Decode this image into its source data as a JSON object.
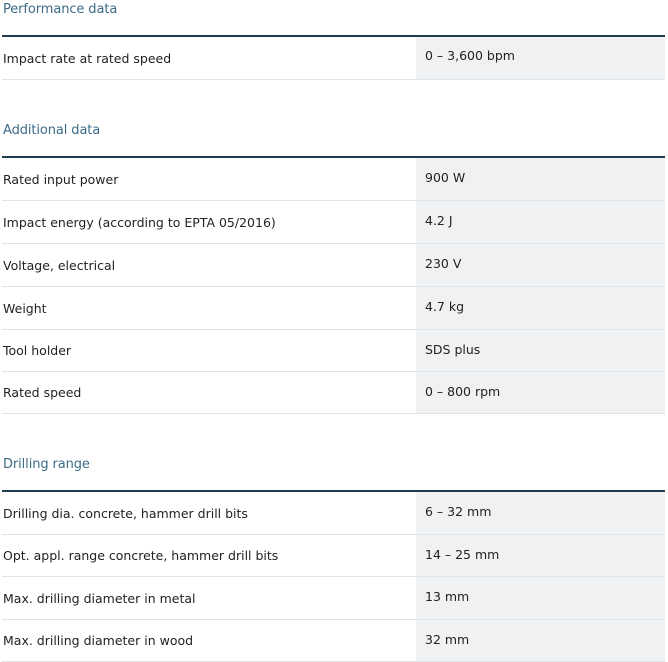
{
  "sections": [
    {
      "title": "Performance data",
      "rows": [
        {
          "label": "Impact rate at rated speed",
          "value": "0 – 3,600 bpm"
        }
      ]
    },
    {
      "title": "Additional data",
      "rows": [
        {
          "label": "Rated input power",
          "value": "900 W"
        },
        {
          "label": "Impact energy (according to EPTA 05/2016)",
          "value": "4.2 J"
        },
        {
          "label": "Voltage, electrical",
          "value": "230 V"
        },
        {
          "label": "Weight",
          "value": "4.7 kg"
        },
        {
          "label": "Tool holder",
          "value": "SDS plus"
        },
        {
          "label": "Rated speed",
          "value": "0 – 800 rpm"
        }
      ]
    },
    {
      "title": "Drilling range",
      "rows": [
        {
          "label": "Drilling dia. concrete, hammer drill bits",
          "value": "6 – 32 mm"
        },
        {
          "label": "Opt. appl. range concrete, hammer drill bits",
          "value": "14 – 25 mm"
        },
        {
          "label": "Max. drilling diameter in metal",
          "value": "13 mm"
        },
        {
          "label": "Max. drilling diameter in wood",
          "value": "32 mm"
        }
      ]
    }
  ],
  "colors": {
    "section_title": "#3c6b86",
    "table_border": "#1f3b4d",
    "value_bg": "#eff1f2"
  }
}
